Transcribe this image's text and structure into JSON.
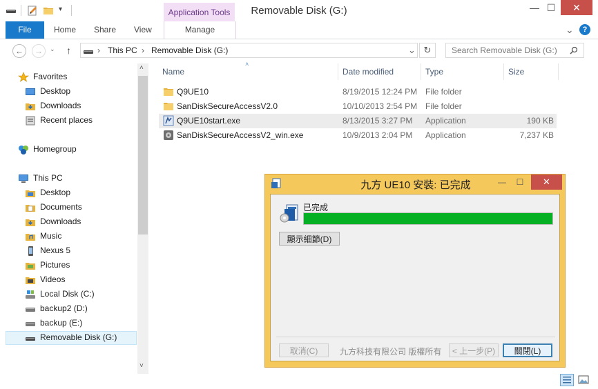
{
  "window": {
    "title": "Removable Disk (G:)",
    "min_glyph": "—",
    "max_glyph": "☐",
    "close_glyph": "✕"
  },
  "ribbon": {
    "context_header": "Application Tools",
    "tabs": [
      "File",
      "Home",
      "Share",
      "View",
      "Manage"
    ],
    "help_glyph": "?",
    "expand_glyph": "⌄"
  },
  "address": {
    "back_glyph": "←",
    "forward_glyph": "→",
    "up_glyph": "↑",
    "crumbs": [
      "This PC",
      "Removable Disk (G:)"
    ],
    "separator": "›",
    "dropdown_glyph": "⌄",
    "refresh_glyph": "↻",
    "search_placeholder": "Search Removable Disk (G:)",
    "search_icon": "search-icon"
  },
  "nav": {
    "favorites": {
      "label": "Favorites",
      "items": [
        "Desktop",
        "Downloads",
        "Recent places"
      ]
    },
    "homegroup": "Homegroup",
    "thispc": {
      "label": "This PC",
      "items": [
        "Desktop",
        "Documents",
        "Downloads",
        "Music",
        "Nexus 5",
        "Pictures",
        "Videos",
        "Local Disk (C:)",
        "backup2 (D:)",
        "backup (E:)",
        "Removable Disk (G:)"
      ]
    },
    "scroll_up": "˄",
    "scroll_down": "˅"
  },
  "files": {
    "columns": [
      "Name",
      "Date modified",
      "Type",
      "Size"
    ],
    "sort_glyph": "˄",
    "rows": [
      {
        "name": "Q9UE10",
        "date": "8/19/2015 12:24 PM",
        "type": "File folder",
        "size": "",
        "icon": "folder-icon"
      },
      {
        "name": "SanDiskSecureAccessV2.0",
        "date": "10/10/2013 2:54 PM",
        "type": "File folder",
        "size": "",
        "icon": "folder-icon"
      },
      {
        "name": "Q9UE10start.exe",
        "date": "8/13/2015 3:27 PM",
        "type": "Application",
        "size": "190 KB",
        "icon": "app-icon"
      },
      {
        "name": "SanDiskSecureAccessV2_win.exe",
        "date": "10/9/2013 2:04 PM",
        "type": "Application",
        "size": "7,237 KB",
        "icon": "app-icon"
      }
    ]
  },
  "dialog": {
    "title": "九方 UE10 安裝: 已完成",
    "status": "已完成",
    "progress_fraction": 1.0,
    "details_button": "顯示細節(D)",
    "cancel_button": "取消(C)",
    "copyright": "九方科技有限公司 版權所有",
    "back_button": "< 上一步(P)",
    "close_button": "關閉(L)",
    "close_glyph": "✕",
    "min_glyph": "—",
    "max_glyph": "☐"
  },
  "colors": {
    "accent": "#1979ca",
    "context_tab": "#f3dff5",
    "dialog_frame": "#f5c85c",
    "progress": "#06b025",
    "close_red": "#c7504b"
  }
}
